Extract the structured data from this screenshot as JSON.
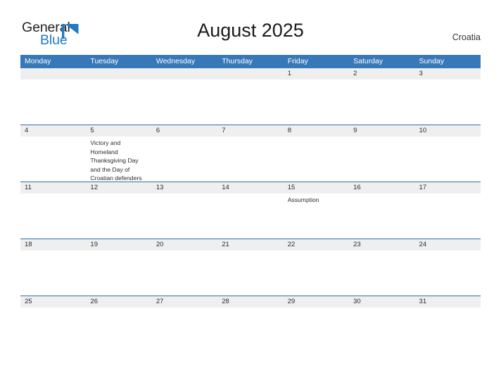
{
  "logo": {
    "text_primary": "General",
    "text_secondary": "Blue",
    "mark": "blue-flag-triangle"
  },
  "header": {
    "title": "August 2025",
    "region": "Croatia"
  },
  "calendar": {
    "weekdays": [
      "Monday",
      "Tuesday",
      "Wednesday",
      "Thursday",
      "Friday",
      "Saturday",
      "Sunday"
    ],
    "colors": {
      "header_blue": "#3778b8",
      "row_rule_blue": "#2f6fad",
      "day_band_gray": "#efefef",
      "logo_blue": "#1f7ac4"
    },
    "weeks": [
      {
        "days": [
          {
            "number": "",
            "empty": true,
            "events": []
          },
          {
            "number": "",
            "empty": true,
            "events": []
          },
          {
            "number": "",
            "empty": true,
            "events": []
          },
          {
            "number": "",
            "empty": true,
            "events": []
          },
          {
            "number": "1",
            "empty": false,
            "events": []
          },
          {
            "number": "2",
            "empty": false,
            "events": []
          },
          {
            "number": "3",
            "empty": false,
            "events": []
          }
        ]
      },
      {
        "days": [
          {
            "number": "4",
            "empty": false,
            "events": []
          },
          {
            "number": "5",
            "empty": false,
            "events": [
              "Victory and Homeland Thanksgiving Day and the Day of Croatian defenders"
            ]
          },
          {
            "number": "6",
            "empty": false,
            "events": []
          },
          {
            "number": "7",
            "empty": false,
            "events": []
          },
          {
            "number": "8",
            "empty": false,
            "events": []
          },
          {
            "number": "9",
            "empty": false,
            "events": []
          },
          {
            "number": "10",
            "empty": false,
            "events": []
          }
        ]
      },
      {
        "days": [
          {
            "number": "11",
            "empty": false,
            "events": []
          },
          {
            "number": "12",
            "empty": false,
            "events": []
          },
          {
            "number": "13",
            "empty": false,
            "events": []
          },
          {
            "number": "14",
            "empty": false,
            "events": []
          },
          {
            "number": "15",
            "empty": false,
            "events": [
              "Assumption"
            ]
          },
          {
            "number": "16",
            "empty": false,
            "events": []
          },
          {
            "number": "17",
            "empty": false,
            "events": []
          }
        ]
      },
      {
        "days": [
          {
            "number": "18",
            "empty": false,
            "events": []
          },
          {
            "number": "19",
            "empty": false,
            "events": []
          },
          {
            "number": "20",
            "empty": false,
            "events": []
          },
          {
            "number": "21",
            "empty": false,
            "events": []
          },
          {
            "number": "22",
            "empty": false,
            "events": []
          },
          {
            "number": "23",
            "empty": false,
            "events": []
          },
          {
            "number": "24",
            "empty": false,
            "events": []
          }
        ]
      },
      {
        "days": [
          {
            "number": "25",
            "empty": false,
            "events": []
          },
          {
            "number": "26",
            "empty": false,
            "events": []
          },
          {
            "number": "27",
            "empty": false,
            "events": []
          },
          {
            "number": "28",
            "empty": false,
            "events": []
          },
          {
            "number": "29",
            "empty": false,
            "events": []
          },
          {
            "number": "30",
            "empty": false,
            "events": []
          },
          {
            "number": "31",
            "empty": false,
            "events": []
          }
        ]
      }
    ]
  }
}
